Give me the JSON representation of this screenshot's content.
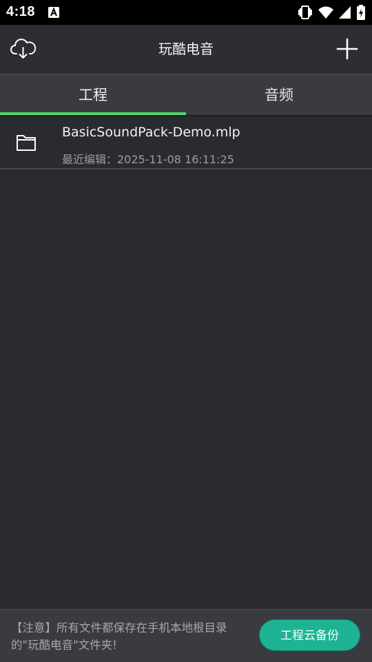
{
  "status_bar": {
    "time": "4:18"
  },
  "app_bar": {
    "title": "玩酷电音"
  },
  "tabs": [
    {
      "label": "工程",
      "selected": true
    },
    {
      "label": "音频",
      "selected": false
    }
  ],
  "projects": [
    {
      "name": "BasicSoundPack-Demo.mlp",
      "meta": "最近编辑：2025-11-08 16:11:25"
    }
  ],
  "footer": {
    "note": "【注意】所有文件都保存在手机本地根目录的\"玩酷电音\"文件夹!",
    "backup_button": "工程云备份"
  },
  "colors": {
    "accent": "#4fdc6a",
    "button": "#1db394",
    "background": "#2a2b30"
  }
}
